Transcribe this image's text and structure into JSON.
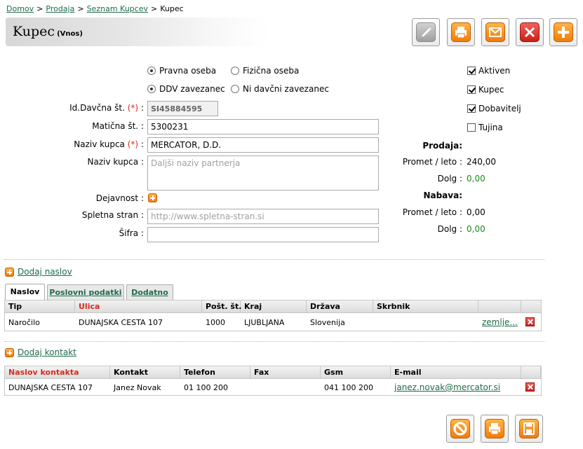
{
  "breadcrumb": {
    "items": [
      "Domov",
      "Prodaja",
      "Seznam Kupcev"
    ],
    "current": "Kupec",
    "separator": ">"
  },
  "header": {
    "title": "Kupec",
    "subtitle": "(Vnos)"
  },
  "toolbar": {
    "icons": [
      "pencil-icon",
      "printer-icon",
      "envelope-icon",
      "close-icon",
      "plus-icon"
    ]
  },
  "form": {
    "radio_type": {
      "opt1": "Pravna oseba",
      "opt2": "Fizična oseba",
      "selected": "Pravna oseba"
    },
    "radio_vat": {
      "opt1": "DDV zavezanec",
      "opt2": "Ni davčni zavezanec",
      "selected": "DDV zavezanec"
    },
    "vat_id": {
      "label": "Id.Davčna št.",
      "req": "(*)",
      "value": "SI45884595"
    },
    "reg_no": {
      "label": "Matična št.",
      "value": "5300231"
    },
    "name": {
      "label": "Naziv kupca",
      "req": "(*)",
      "value": "MERCATOR, D.D."
    },
    "name2": {
      "label": "Naziv kupca",
      "placeholder": "Daljši naziv partnerja"
    },
    "activity": {
      "label": "Dejavnost"
    },
    "website": {
      "label": "Spletna stran",
      "placeholder": "http://www.spletna-stran.si"
    },
    "code": {
      "label": "Šifra",
      "value": ""
    },
    "colon": ":"
  },
  "flags": [
    {
      "label": "Aktiven",
      "checked": true
    },
    {
      "label": "Kupec",
      "checked": true
    },
    {
      "label": "Dobavitelj",
      "checked": true
    },
    {
      "label": "Tujina",
      "checked": false
    }
  ],
  "stats": {
    "sales": {
      "heading": "Prodaja:",
      "turnover_label": "Promet / leto :",
      "turnover": "240,00",
      "debt_label": "Dolg :",
      "debt": "0,00"
    },
    "purchase": {
      "heading": "Nabava:",
      "turnover_label": "Promet / leto :",
      "turnover": "0,00",
      "debt_label": "Dolg :",
      "debt": "0,00"
    }
  },
  "address_section": {
    "add_label": "Dodaj naslov",
    "tabs": [
      "Naslov",
      "Poslovni podatki",
      "Dodatno"
    ],
    "columns": [
      "Tip",
      "Ulica",
      "Pošt. št.",
      "Kraj",
      "Država",
      "Skrbnik"
    ],
    "rows": [
      {
        "tip": "Naročilo",
        "ulica": "DUNAJSKA CESTA 107",
        "post": "1000",
        "kraj": "LJUBLJANA",
        "drzava": "Slovenija",
        "skrbnik": "",
        "link": "zemlje..."
      }
    ]
  },
  "contact_section": {
    "add_label": "Dodaj kontakt",
    "columns": [
      "Naslov kontakta",
      "Kontakt",
      "Telefon",
      "Fax",
      "Gsm",
      "E-mail"
    ],
    "rows": [
      {
        "naslov": "DUNAJSKA CESTA 107",
        "kontakt": "Janez Novak",
        "telefon": "01 100 200",
        "fax": "",
        "gsm": "041 100 200",
        "email": "janez.novak@mercator.si"
      }
    ]
  },
  "footer": {
    "icons": [
      "cancel-icon",
      "printer-icon",
      "save-icon"
    ]
  },
  "colors": {
    "link": "#1e6b4a",
    "required": "#d42c1f",
    "orange": "#f07c0c",
    "red": "#c9201b",
    "positive": "#1a8a1a"
  }
}
